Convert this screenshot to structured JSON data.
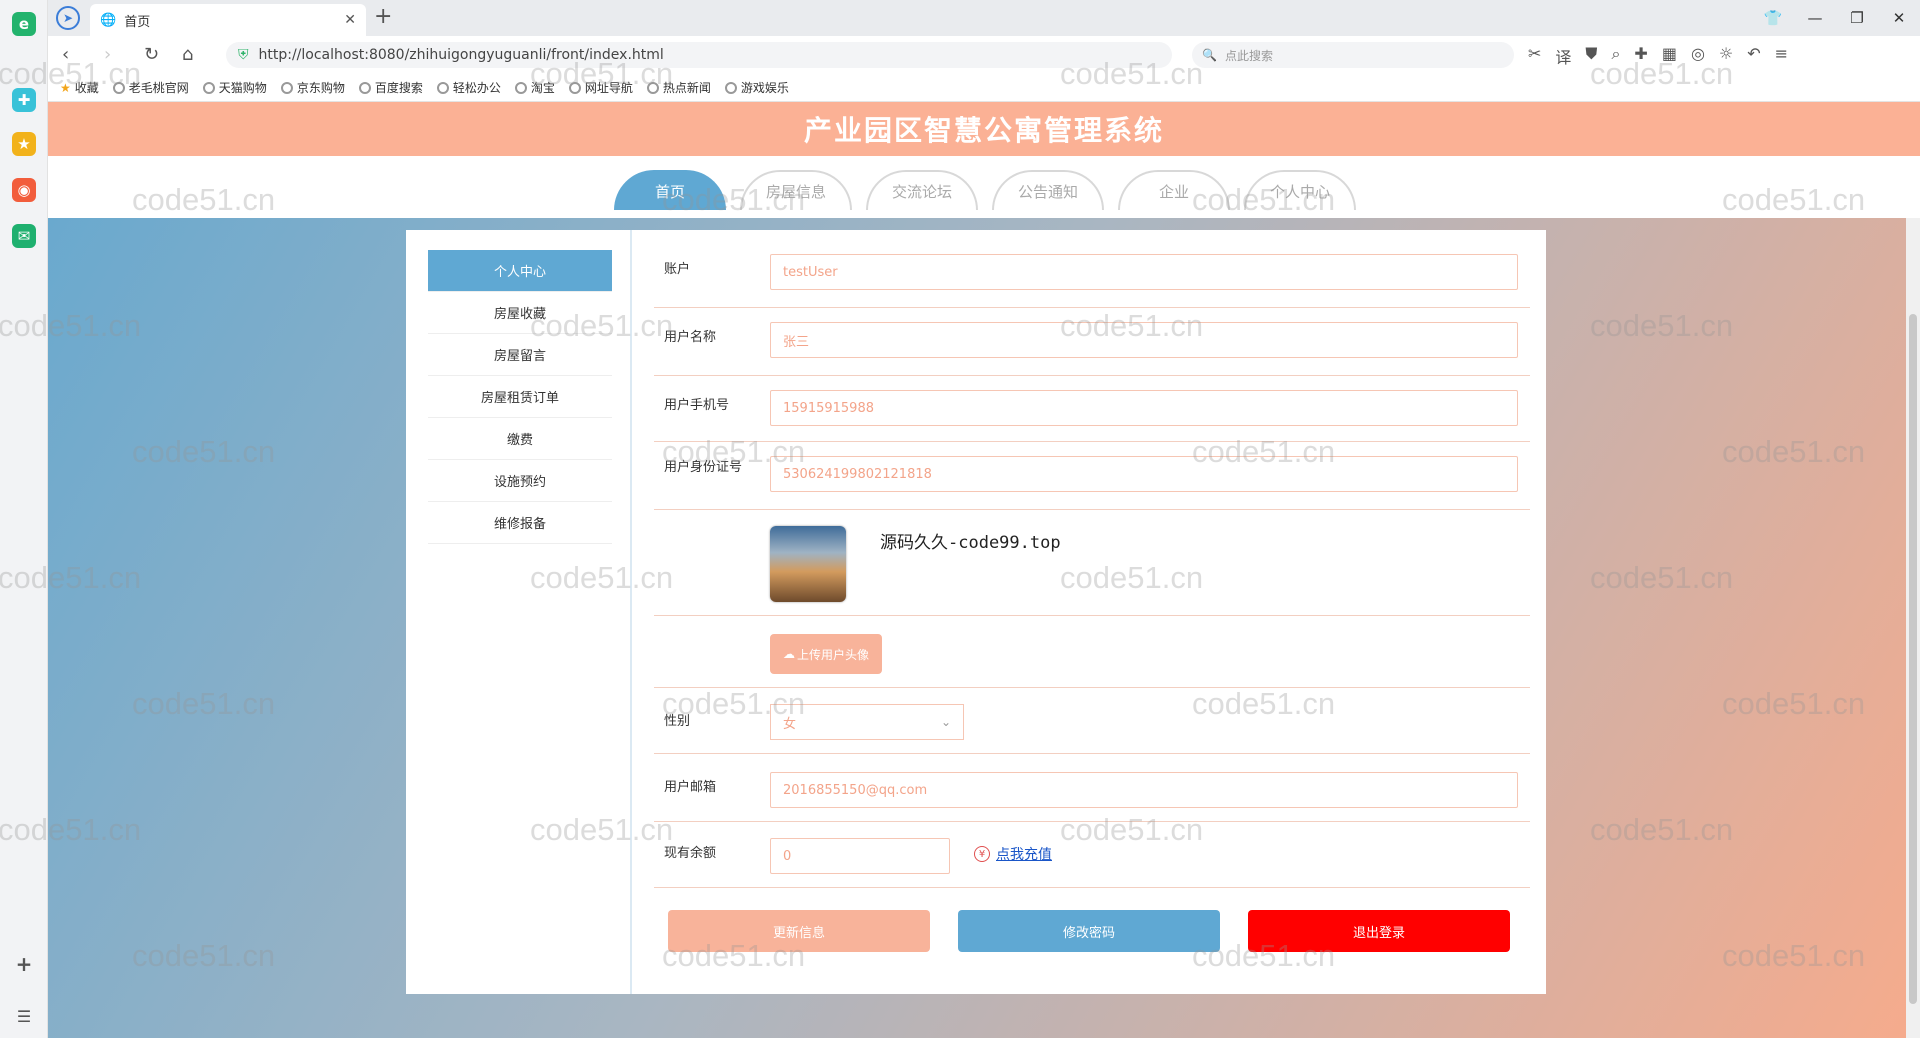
{
  "browser": {
    "tab_title": "首页",
    "url": "http://localhost:8080/zhihuigongyuguanli/front/index.html",
    "search_placeholder": "点此搜索",
    "bookmarks": [
      "收藏",
      "老毛桃官网",
      "天猫购物",
      "京东购物",
      "百度搜索",
      "轻松办公",
      "淘宝",
      "网址导航",
      "热点新闻",
      "游戏娱乐"
    ]
  },
  "site": {
    "title": "产业园区智慧公寓管理系统",
    "nav": [
      "首页",
      "房屋信息",
      "交流论坛",
      "公告通知",
      "企业",
      "个人中心"
    ],
    "active_nav": "首页"
  },
  "sidebar": {
    "items": [
      "个人中心",
      "房屋收藏",
      "房屋留言",
      "房屋租赁订单",
      "缴费",
      "设施预约",
      "维修报备"
    ]
  },
  "form": {
    "account_label": "账户",
    "account_value": "testUser",
    "username_label": "用户名称",
    "username_value": "张三",
    "phone_label": "用户手机号",
    "phone_value": "15915915988",
    "idcard_label": "用户身份证号",
    "idcard_value": "530624199802121818",
    "avatar_watermark": "源码久久-code99.top",
    "upload_label": "上传用户头像",
    "gender_label": "性别",
    "gender_value": "女",
    "email_label": "用户邮箱",
    "email_value": "2016855150@qq.com",
    "balance_label": "现有余额",
    "balance_value": "0",
    "recharge_label": "点我充值"
  },
  "buttons": {
    "update": "更新信息",
    "change_password": "修改密码",
    "logout": "退出登录"
  },
  "colors": {
    "banner": "#fbb195",
    "active_blue": "#5fa8d3",
    "update_button": "#f8b39a",
    "logout_button": "#ff0000"
  },
  "watermark_text": "code51.cn"
}
